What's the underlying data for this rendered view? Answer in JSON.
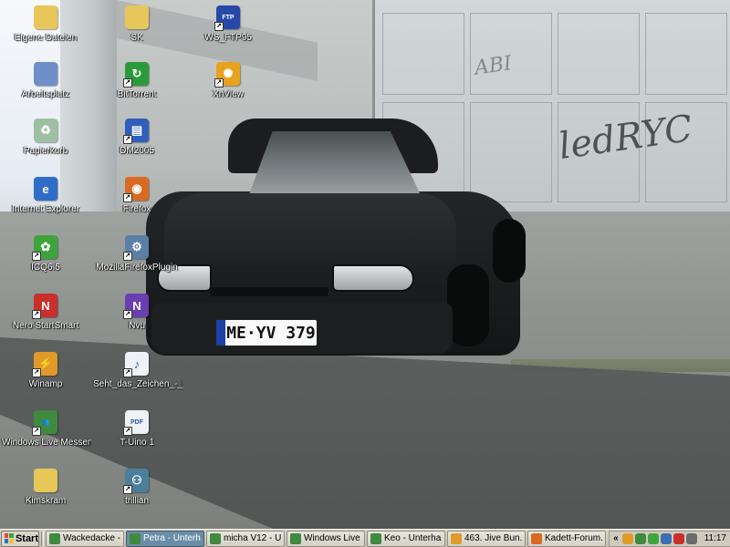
{
  "desktop": {
    "icons": [
      {
        "label": "Eigene Dateien",
        "icon": "documents-folder-icon",
        "color": "#e7c65a",
        "glyph": "",
        "shortcut": false
      },
      {
        "label": "Arbeitsplatz",
        "icon": "my-computer-icon",
        "color": "#6f8fc8",
        "glyph": "",
        "shortcut": false
      },
      {
        "label": "Papierkorb",
        "icon": "recycle-bin-icon",
        "color": "#9fbfa2",
        "glyph": "♻",
        "shortcut": false
      },
      {
        "label": "Internet Explorer",
        "icon": "internet-explorer-icon",
        "color": "#2f6dc9",
        "glyph": "e",
        "shortcut": false
      },
      {
        "label": "ICQ6.5",
        "icon": "icq-flower-icon",
        "color": "#3ea53a",
        "glyph": "✿",
        "shortcut": true
      },
      {
        "label": "Nero StartSmart",
        "icon": "nero-icon",
        "color": "#c9302c",
        "glyph": "N",
        "shortcut": true
      },
      {
        "label": "Winamp",
        "icon": "winamp-icon",
        "color": "#e09a2a",
        "glyph": "⚡",
        "shortcut": true
      },
      {
        "label": "Windows Live Messenger",
        "icon": "messenger-icon",
        "color": "#3f8a3f",
        "glyph": "👥",
        "shortcut": true
      },
      {
        "label": "Kimskram",
        "icon": "folder-icon",
        "color": "#e7c65a",
        "glyph": "",
        "shortcut": false
      },
      {
        "label": "SK",
        "icon": "folder-icon",
        "color": "#e7c65a",
        "glyph": "",
        "shortcut": false
      },
      {
        "label": "BitTorrent",
        "icon": "bittorrent-icon",
        "color": "#2b9a3a",
        "glyph": "↻",
        "shortcut": true
      },
      {
        "label": "DM2005",
        "icon": "dm2005-window-icon",
        "color": "#2f5fb8",
        "glyph": "▤",
        "shortcut": true
      },
      {
        "label": "Firefox",
        "icon": "firefox-icon",
        "color": "#d96a1f",
        "glyph": "◉",
        "shortcut": true
      },
      {
        "label": "MozillaFirefoxPlugin",
        "icon": "plugin-icon",
        "color": "#5c7fa8",
        "glyph": "⚙",
        "shortcut": true
      },
      {
        "label": "Nvu",
        "icon": "nvu-icon",
        "color": "#6b3fb0",
        "glyph": "N",
        "shortcut": true
      },
      {
        "label": "Seht_das_Zeichen_-_Ki...",
        "icon": "document-icon",
        "color": "#eef2f6",
        "glyph": "♪",
        "shortcut": true
      },
      {
        "label": "T-Uino 1",
        "icon": "pdf-document-icon",
        "color": "#eef2f6",
        "glyph": "PDF",
        "shortcut": true
      },
      {
        "label": "trillian",
        "icon": "trillian-icon",
        "color": "#4c7f9c",
        "glyph": "⚇",
        "shortcut": true
      },
      {
        "label": "WS_FTP95",
        "icon": "ws-ftp-icon",
        "color": "#2748a8",
        "glyph": "FTP",
        "shortcut": true
      },
      {
        "label": "XnView",
        "icon": "xnview-icon",
        "color": "#e8a21e",
        "glyph": "✺",
        "shortcut": true
      }
    ]
  },
  "wallpaper": {
    "plate": "ME·YV 379",
    "graffiti_1": "ledRYC",
    "graffiti_2": "ABI"
  },
  "taskbar": {
    "start_label": "Start",
    "tasks": [
      {
        "label": "Wackedacke - ...",
        "icon": "messenger-icon",
        "color": "#3f8a3f",
        "active": false
      },
      {
        "label": "Petra - Unterh...",
        "icon": "messenger-icon",
        "color": "#3f8a3f",
        "active": true
      },
      {
        "label": "micha V12 - U...",
        "icon": "messenger-icon",
        "color": "#3f8a3f",
        "active": false
      },
      {
        "label": "Windows Live ...",
        "icon": "messenger-icon",
        "color": "#3f8a3f",
        "active": false
      },
      {
        "label": "Keo - Unterhal...",
        "icon": "messenger-icon",
        "color": "#3f8a3f",
        "active": false
      },
      {
        "label": "463. Jive Bun...",
        "icon": "winamp-icon",
        "color": "#e09a2a",
        "active": false
      },
      {
        "label": "Kadett-Forum....",
        "icon": "firefox-icon",
        "color": "#d96a1f",
        "active": false
      }
    ],
    "tray": {
      "expand_glyph": "«",
      "icons": [
        {
          "icon": "winamp-tray-icon",
          "color": "#e09a2a"
        },
        {
          "icon": "messenger-tray-icon",
          "color": "#3f8a3f"
        },
        {
          "icon": "icq-tray-icon",
          "color": "#3ea53a"
        },
        {
          "icon": "network-tray-icon",
          "color": "#3b6fb4"
        },
        {
          "icon": "antivirus-tray-icon",
          "color": "#c9302c"
        },
        {
          "icon": "volume-tray-icon",
          "color": "#6b6b6b"
        }
      ],
      "clock": "11:17"
    }
  }
}
